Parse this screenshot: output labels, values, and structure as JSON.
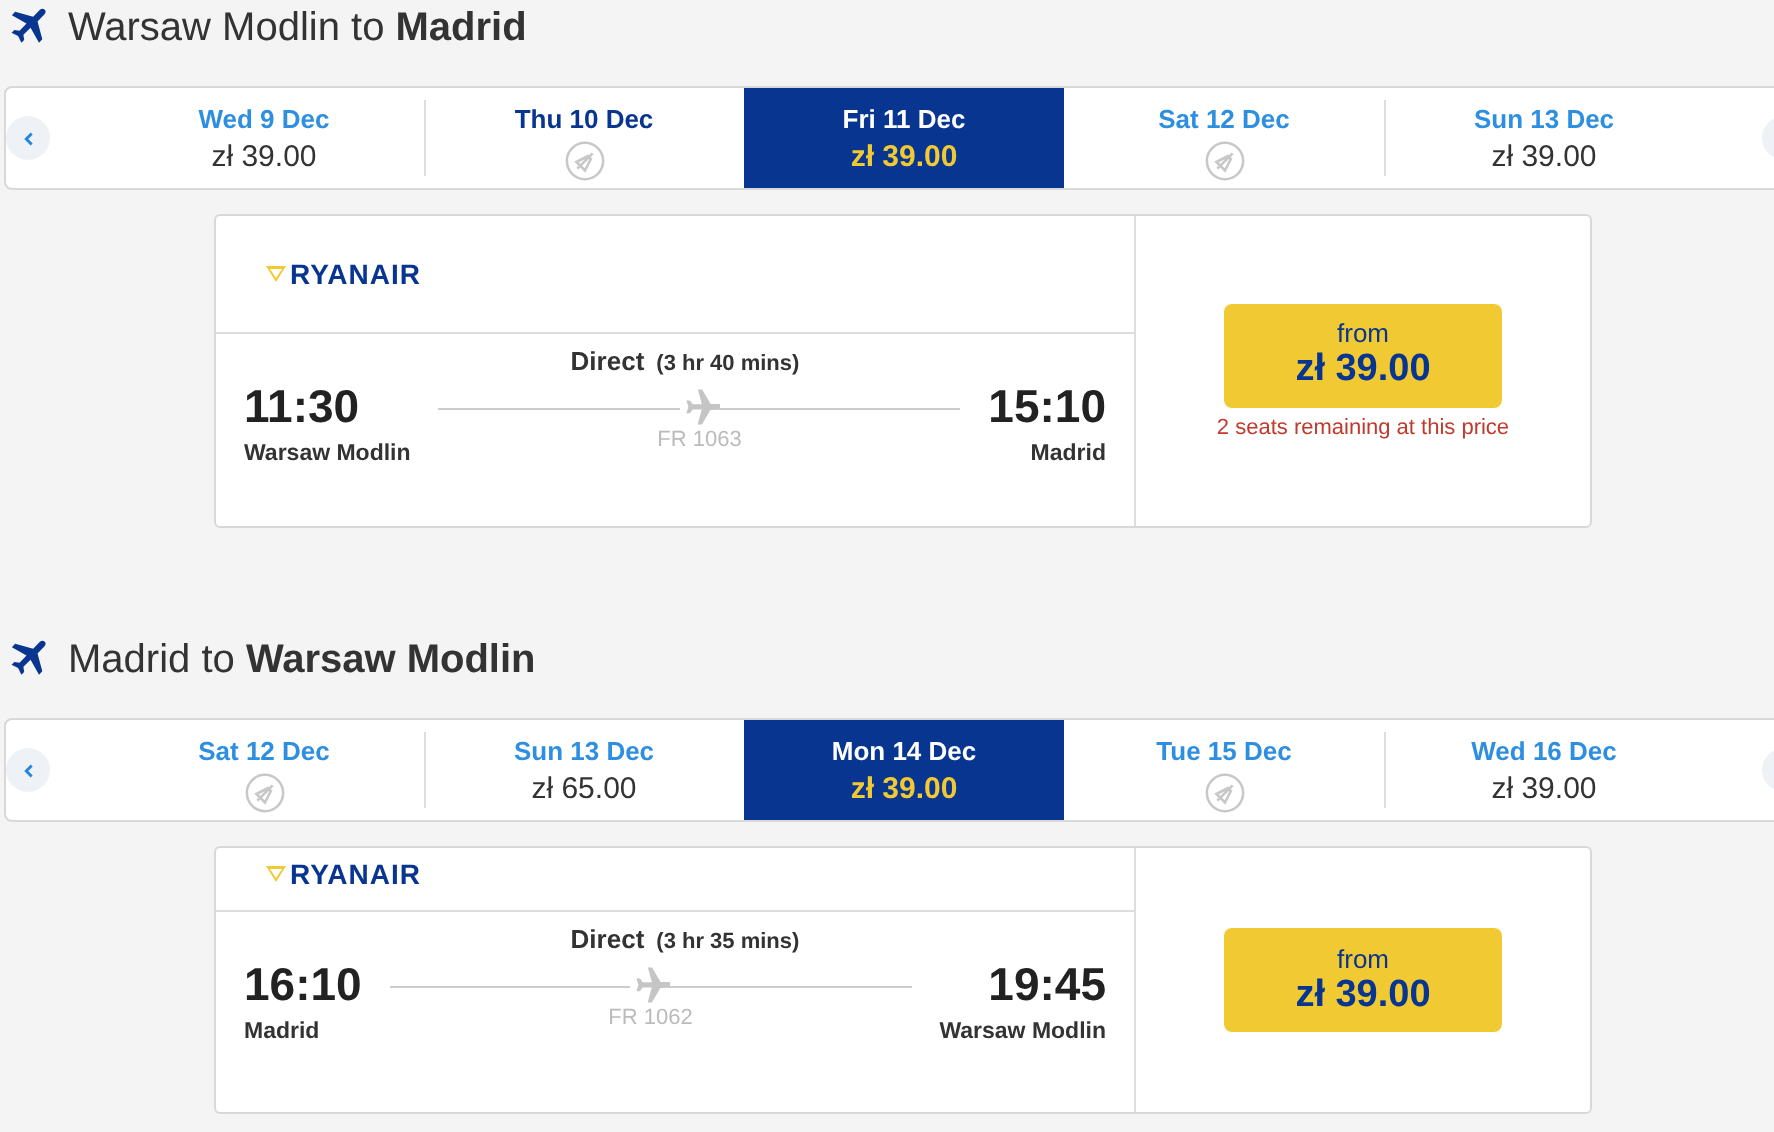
{
  "journeys": [
    {
      "title_prefix": "Warsaw Modlin to",
      "title_destination": "Madrid",
      "dates": [
        {
          "label": "Wed 9 Dec",
          "price": "zł 39.00",
          "selected": false,
          "hovered": false
        },
        {
          "label": "Thu 10 Dec",
          "selected": false,
          "hovered": true
        },
        {
          "label": "Fri 11 Dec",
          "price": "zł 39.00",
          "selected": true,
          "hovered": false
        },
        {
          "label": "Sat 12 Dec",
          "selected": false,
          "hovered": false
        },
        {
          "label": "Sun 13 Dec",
          "price": "zł 39.00",
          "selected": false,
          "hovered": false
        }
      ],
      "flight": {
        "airline": "RYANAIR",
        "type": "Direct",
        "duration": "(3 hr 40 mins)",
        "depart_time": "11:30",
        "depart_airport": "Warsaw Modlin",
        "arrive_time": "15:10",
        "arrive_airport": "Madrid",
        "flight_number": "FR 1063",
        "price_label": "from",
        "price": "zł 39.00",
        "seats_note": "2 seats remaining at this price"
      }
    },
    {
      "title_prefix": "Madrid to",
      "title_destination": "Warsaw Modlin",
      "dates": [
        {
          "label": "Sat 12 Dec",
          "selected": false,
          "hovered": false
        },
        {
          "label": "Sun 13 Dec",
          "price": "zł 65.00",
          "selected": false,
          "hovered": false
        },
        {
          "label": "Mon 14 Dec",
          "price": "zł 39.00",
          "selected": true,
          "hovered": false
        },
        {
          "label": "Tue 15 Dec",
          "selected": false,
          "hovered": false
        },
        {
          "label": "Wed 16 Dec",
          "price": "zł 39.00",
          "selected": false,
          "hovered": false
        }
      ],
      "flight": {
        "airline": "RYANAIR",
        "type": "Direct",
        "duration": "(3 hr 35 mins)",
        "depart_time": "16:10",
        "depart_airport": "Madrid",
        "arrive_time": "19:45",
        "arrive_airport": "Warsaw Modlin",
        "flight_number": "FR 1062",
        "price_label": "from",
        "price": "zł 39.00"
      }
    }
  ]
}
